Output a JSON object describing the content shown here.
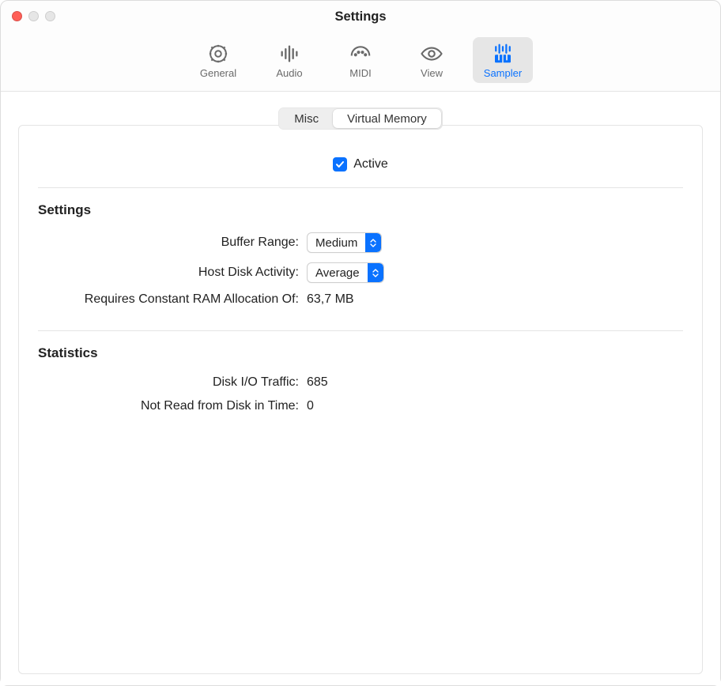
{
  "window": {
    "title": "Settings"
  },
  "toolbar": {
    "items": [
      {
        "label": "General"
      },
      {
        "label": "Audio"
      },
      {
        "label": "MIDI"
      },
      {
        "label": "View"
      },
      {
        "label": "Sampler"
      }
    ]
  },
  "segmented": {
    "misc": "Misc",
    "virtual_memory": "Virtual Memory"
  },
  "active": {
    "label": "Active",
    "checked": true
  },
  "settings": {
    "heading": "Settings",
    "buffer_range_label": "Buffer Range:",
    "buffer_range_value": "Medium",
    "host_disk_label": "Host Disk Activity:",
    "host_disk_value": "Average",
    "ram_label": "Requires Constant RAM Allocation Of:",
    "ram_value": "63,7 MB"
  },
  "statistics": {
    "heading": "Statistics",
    "disk_io_label": "Disk I/O Traffic:",
    "disk_io_value": "685",
    "not_read_label": "Not Read from Disk in Time:",
    "not_read_value": "0"
  }
}
